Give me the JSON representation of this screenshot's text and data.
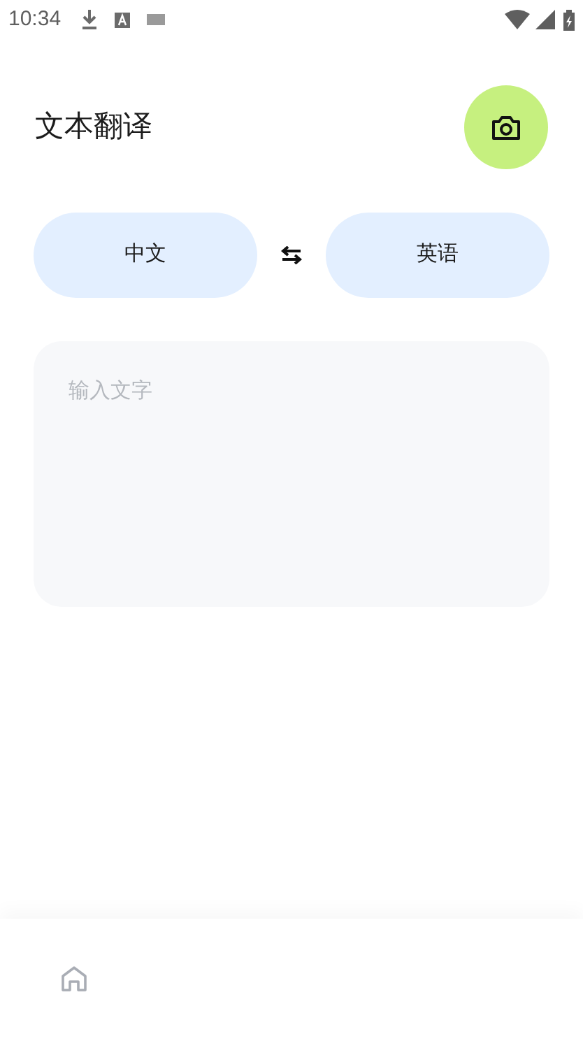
{
  "status_bar": {
    "time": "10:34"
  },
  "header": {
    "title": "文本翻译"
  },
  "languages": {
    "source": "中文",
    "target": "英语"
  },
  "input": {
    "placeholder": "输入文字"
  }
}
